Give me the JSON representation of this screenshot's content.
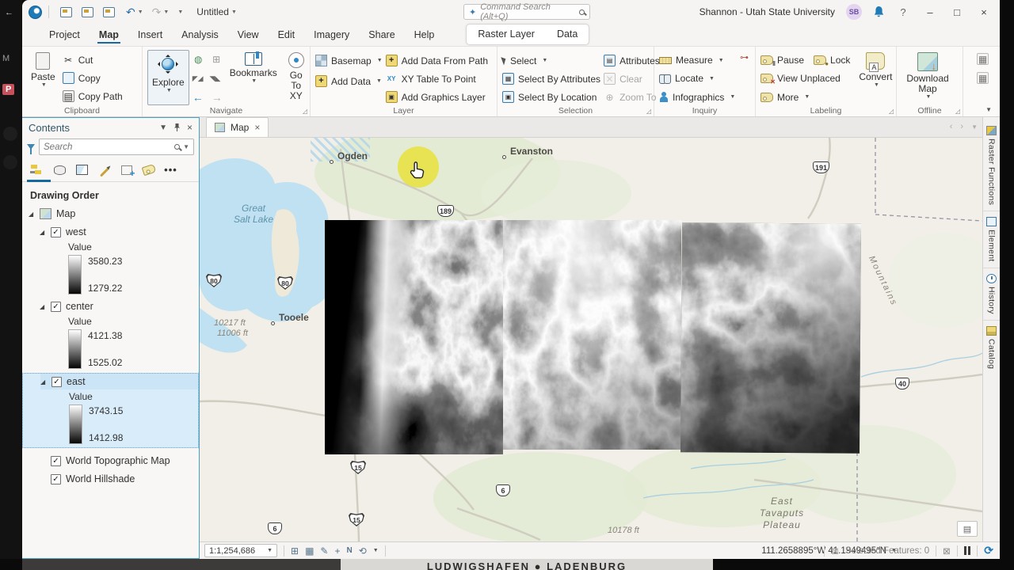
{
  "bg": {
    "video_text": "LUDWIGSHAFEN ● LADENBURG",
    "left_letter_m": "M",
    "left_letter_p": "P"
  },
  "win": {
    "title": "Untitled",
    "cmd_search": "Command Search (Alt+Q)",
    "account": "Shannon - Utah State University",
    "initials": "SB"
  },
  "ribbon": {
    "tabs": [
      "Project",
      "Map",
      "Insert",
      "Analysis",
      "View",
      "Edit",
      "Imagery",
      "Share",
      "Help"
    ],
    "ctx_tabs": [
      "Raster Layer",
      "Data"
    ],
    "clipboard": {
      "label": "Clipboard",
      "paste": "Paste",
      "cut": "Cut",
      "copy": "Copy",
      "copy_path": "Copy Path"
    },
    "navigate": {
      "label": "Navigate",
      "explore": "Explore",
      "bookmarks": "Bookmarks",
      "goto": "Go To XY"
    },
    "layer": {
      "label": "Layer",
      "basemap": "Basemap",
      "add_data": "Add Data",
      "from_path": "Add Data From Path",
      "xy_table": "XY Table To Point",
      "graphics": "Add Graphics Layer"
    },
    "selection": {
      "label": "Selection",
      "select": "Select",
      "by_attr": "Select By Attributes",
      "by_loc": "Select By Location",
      "attributes": "Attributes",
      "clear": "Clear",
      "zoom_to": "Zoom To"
    },
    "inquiry": {
      "label": "Inquiry",
      "measure": "Measure",
      "locate": "Locate",
      "infographics": "Infographics"
    },
    "labeling": {
      "label": "Labeling",
      "pause": "Pause",
      "lock": "Lock",
      "unplaced": "View Unplaced",
      "more": "More",
      "convert": "Convert"
    },
    "offline": {
      "label": "Offline",
      "download": "Download Map"
    }
  },
  "contents": {
    "title": "Contents",
    "search_placeholder": "Search",
    "heading": "Drawing Order",
    "map": "Map",
    "layers": [
      {
        "name": "west",
        "value": "Value",
        "max": "3580.23",
        "min": "1279.22"
      },
      {
        "name": "center",
        "value": "Value",
        "max": "4121.38",
        "min": "1525.02"
      },
      {
        "name": "east",
        "value": "Value",
        "max": "3743.15",
        "min": "1412.98"
      }
    ],
    "basemaps": [
      "World Topographic Map",
      "World Hillshade"
    ]
  },
  "map": {
    "tab": "Map",
    "labels": {
      "ogden": "Ogden",
      "evanston": "Evanston",
      "lake": "Great Salt Lake",
      "tooele": "Tooele",
      "plateau": "East Tavaputs Plateau",
      "mountains": "Mountains",
      "elev1": "10217 ft",
      "elev2": "11006 ft",
      "elev3": "10178 ft"
    },
    "shields": {
      "s189": "189",
      "i80": "80",
      "i15": "15",
      "s6": "6",
      "s40": "40",
      "s191": "191"
    }
  },
  "status": {
    "scale": "1:1,254,686",
    "coords": "111.2658895°W 41.1949495°N",
    "selected": "Selected Features: 0"
  },
  "right_tabs": [
    "Raster Functions",
    "Element",
    "History",
    "Catalog"
  ]
}
